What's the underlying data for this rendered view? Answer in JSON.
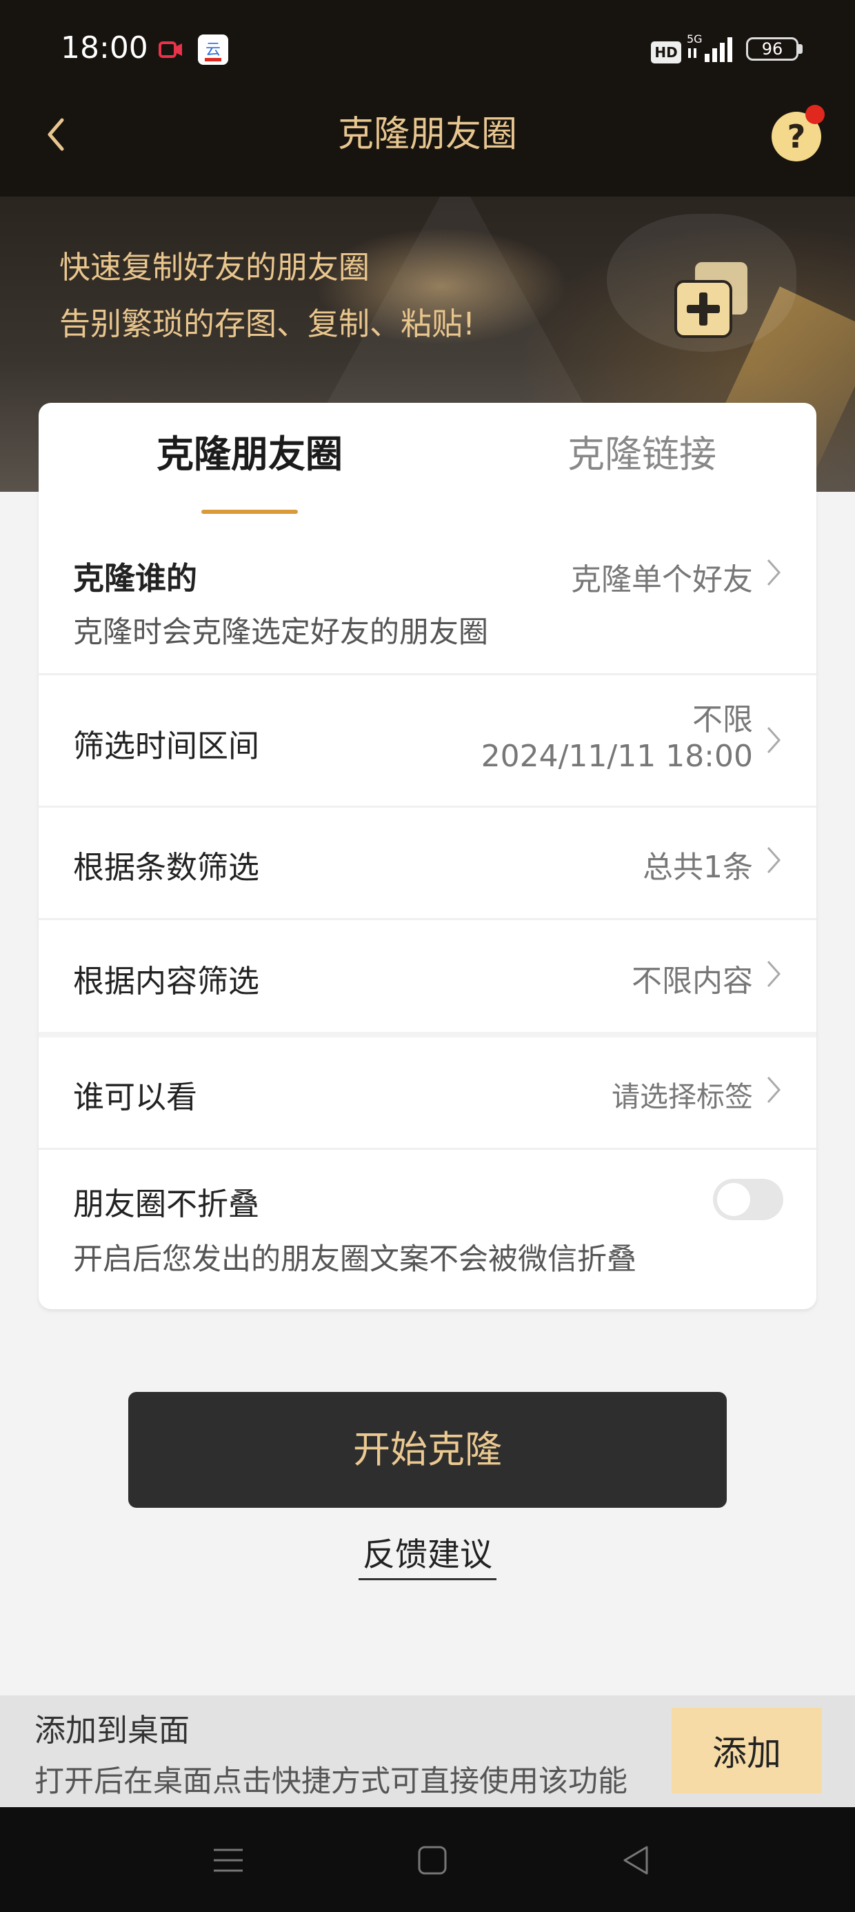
{
  "status_bar": {
    "time": "18:00",
    "hd_label": "HD",
    "network_label": "5G",
    "battery_level": "96"
  },
  "nav": {
    "title": "克隆朋友圈",
    "back_icon": "chevron-left-icon",
    "help_label": "?"
  },
  "banner": {
    "line1": "快速复制好友的朋友圈",
    "line2": "告别繁琐的存图、复制、粘贴!"
  },
  "tabs": [
    {
      "label": "克隆朋友圈",
      "active": true
    },
    {
      "label": "克隆链接",
      "active": false
    }
  ],
  "settings": {
    "clone_whose": {
      "title": "克隆谁的",
      "value": "克隆单个好友",
      "subtitle": "克隆时会克隆选定好友的朋友圈"
    },
    "time_range": {
      "title": "筛选时间区间",
      "value_line1": "不限",
      "value_line2": "2024/11/11 18:00"
    },
    "by_count": {
      "title": "根据条数筛选",
      "value": "总共1条"
    },
    "by_content": {
      "title": "根据内容筛选",
      "value": "不限内容"
    },
    "who_can_see": {
      "title": "谁可以看",
      "value": "请选择标签"
    },
    "no_fold": {
      "title": "朋友圈不折叠",
      "subtitle": "开启后您发出的朋友圈文案不会被微信折叠",
      "enabled": false
    }
  },
  "actions": {
    "start_label": "开始克隆",
    "feedback_label": "反馈建议"
  },
  "add_to_desktop": {
    "title": "添加到桌面",
    "description": "打开后在桌面点击快捷方式可直接使用该功能",
    "button_label": "添加"
  },
  "colors": {
    "accent_gold": "#e8c690",
    "tab_underline": "#d99a3a",
    "dark_button": "#2e2e2e",
    "notification_dot": "#e0281e"
  }
}
